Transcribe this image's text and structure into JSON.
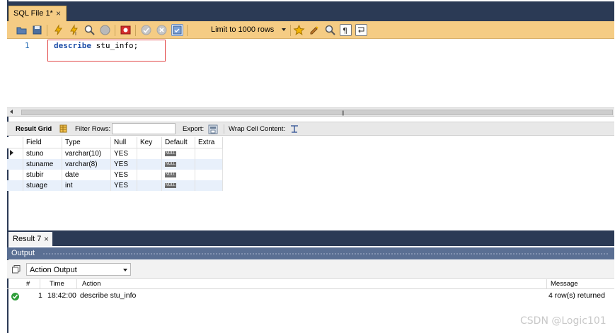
{
  "document_tab": {
    "label": "SQL File 1*",
    "close": "×"
  },
  "toolbar": {
    "limit_select": {
      "value": "Limit to 1000 rows"
    },
    "icons": [
      "open-folder-icon",
      "save-icon",
      "execute-icon",
      "execute-current-icon",
      "explain-icon",
      "stop-icon",
      "toggle-error-icon",
      "commit-icon",
      "rollback-icon",
      "autocommit-icon",
      "beautify-icon",
      "search-icon",
      "invisible-chars-icon",
      "wrap-icon"
    ]
  },
  "editor": {
    "line_number": "1",
    "keyword": "describe",
    "rest": " stu_info;"
  },
  "result_toolbar": {
    "result_grid": "Result Grid",
    "filter_rows": "Filter Rows:",
    "filter_value": "",
    "export": "Export:",
    "wrap_cell": "Wrap Cell Content:"
  },
  "grid": {
    "columns": [
      "Field",
      "Type",
      "Null",
      "Key",
      "Default",
      "Extra"
    ],
    "rows": [
      {
        "field": "stuno",
        "type": "varchar(10)",
        "null": "YES",
        "key": "",
        "default": "NULL",
        "extra": ""
      },
      {
        "field": "stuname",
        "type": "varchar(8)",
        "null": "YES",
        "key": "",
        "default": "NULL",
        "extra": ""
      },
      {
        "field": "stubir",
        "type": "date",
        "null": "YES",
        "key": "",
        "default": "NULL",
        "extra": ""
      },
      {
        "field": "stuage",
        "type": "int",
        "null": "YES",
        "key": "",
        "default": "NULL",
        "extra": ""
      }
    ]
  },
  "result_tab": {
    "label": "Result 7",
    "close": "×"
  },
  "output": {
    "header": "Output",
    "select_value": "Action Output",
    "columns": {
      "num": "#",
      "time": "Time",
      "action": "Action",
      "message": "Message"
    },
    "row": {
      "num": "1",
      "time": "18:42:00",
      "action": "describe stu_info",
      "message": "4 row(s) returned"
    }
  },
  "watermark": "CSDN @Logic101"
}
